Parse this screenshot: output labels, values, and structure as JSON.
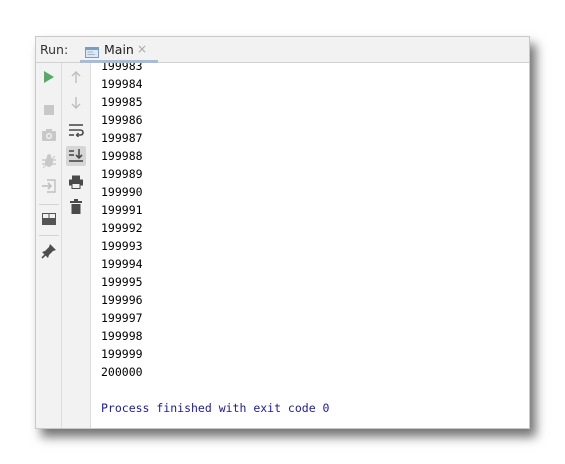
{
  "run_panel": {
    "label": "Run:",
    "tab": {
      "label": "Main",
      "close_glyph": "×",
      "icon": "console-icon"
    }
  },
  "left_toolbar": [
    {
      "icon": "rerun-icon",
      "state": "enabled",
      "color": "#59a869"
    },
    {
      "icon": "stop-icon",
      "state": "disabled"
    },
    {
      "icon": "camera-icon",
      "state": "disabled"
    },
    {
      "icon": "debug-icon",
      "state": "disabled"
    },
    {
      "icon": "login-icon",
      "state": "disabled"
    },
    {
      "icon": "layout-icon",
      "state": "enabled"
    },
    {
      "icon": "pin-icon",
      "state": "enabled"
    }
  ],
  "right_toolbar": [
    {
      "icon": "arrow-up-icon",
      "state": "disabled"
    },
    {
      "icon": "arrow-down-icon",
      "state": "disabled"
    },
    {
      "icon": "soft-wrap-icon",
      "state": "enabled"
    },
    {
      "icon": "scroll-to-end-icon",
      "state": "selected"
    },
    {
      "icon": "print-icon",
      "state": "enabled"
    },
    {
      "icon": "trash-icon",
      "state": "enabled"
    }
  ],
  "console": {
    "lines": [
      "199983",
      "199984",
      "199985",
      "199986",
      "199987",
      "199988",
      "199989",
      "199990",
      "199991",
      "199992",
      "199993",
      "199994",
      "199995",
      "199996",
      "199997",
      "199998",
      "199999",
      "200000"
    ],
    "exit_message": "Process finished with exit code 0",
    "exit_color": "#1b1b9e"
  }
}
